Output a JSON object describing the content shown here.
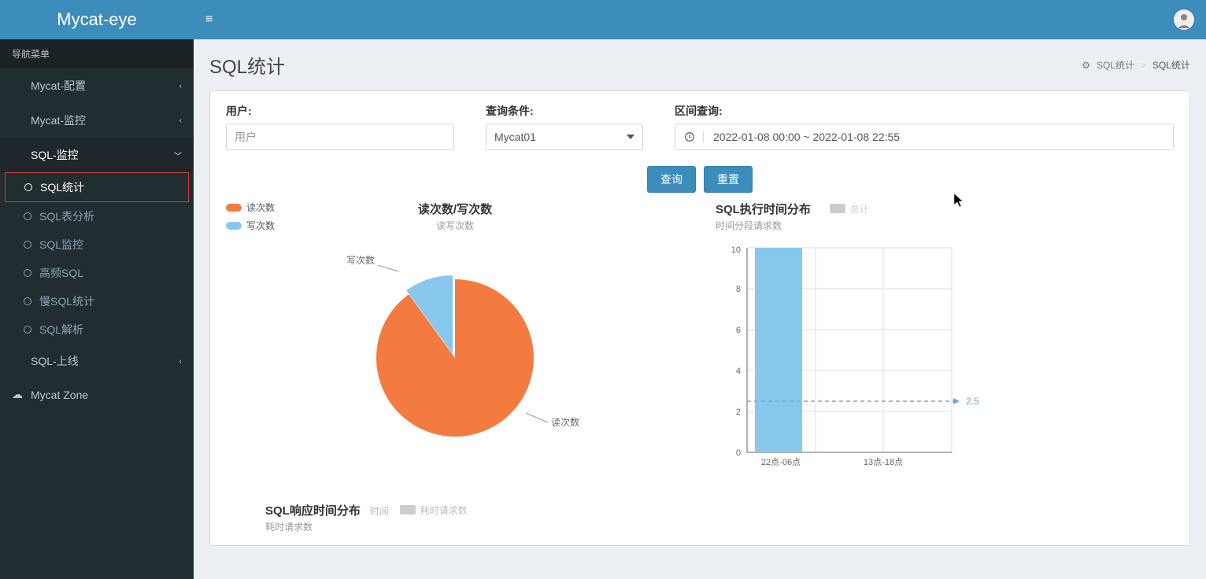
{
  "app_name": "Mycat-eye",
  "nav_header": "导航菜单",
  "sidebar": {
    "items": [
      {
        "label": "Mycat-配置",
        "icon": "grid",
        "caret": "‹"
      },
      {
        "label": "Mycat-监控",
        "icon": "grid",
        "caret": "‹"
      },
      {
        "label": "SQL-监控",
        "icon": "grid",
        "caret": "﹀",
        "expanded": true
      },
      {
        "label": "SQL-上线",
        "icon": "grid",
        "caret": "‹"
      },
      {
        "label": "Mycat Zone",
        "icon": "cloud"
      }
    ],
    "sql_monitor_children": [
      {
        "label": "SQL统计",
        "active": true
      },
      {
        "label": "SQL表分析"
      },
      {
        "label": "SQL监控"
      },
      {
        "label": "高频SQL"
      },
      {
        "label": "慢SQL统计"
      },
      {
        "label": "SQL解析"
      }
    ]
  },
  "page": {
    "title": "SQL统计",
    "breadcrumb": [
      "SQL统计",
      "SQL统计"
    ]
  },
  "filters": {
    "user_label": "用户:",
    "user_placeholder": "用户",
    "cond_label": "查询条件:",
    "cond_value": "Mycat01",
    "range_label": "区间查询:",
    "range_value": "2022-01-08 00:00 ~ 2022-01-08 22:55",
    "btn_query": "查询",
    "btn_reset": "重置"
  },
  "chart_data": [
    {
      "type": "pie",
      "title": "读次数/写次数",
      "subtitle": "读写次数",
      "series": [
        {
          "name": "读次数",
          "value": 85,
          "color": "#f47b3f"
        },
        {
          "name": "写次数",
          "value": 15,
          "color": "#89c8ed"
        }
      ],
      "slice_labels": {
        "read": "读次数",
        "write": "写次数"
      }
    },
    {
      "type": "bar",
      "title": "SQL执行时间分布",
      "subtitle": "时间分段请求数",
      "legend": "总计",
      "categories": [
        "22点-06点",
        "13点-18点"
      ],
      "values": [
        10,
        0
      ],
      "ylim": [
        0,
        10
      ],
      "yticks": [
        0,
        2,
        4,
        6,
        8,
        10
      ],
      "ref_line": 2.5
    },
    {
      "type": "bar",
      "title": "SQL响应时间分布",
      "subtitle": "耗时请求数",
      "legend1": "时间",
      "legend2": "耗时请求数"
    }
  ]
}
